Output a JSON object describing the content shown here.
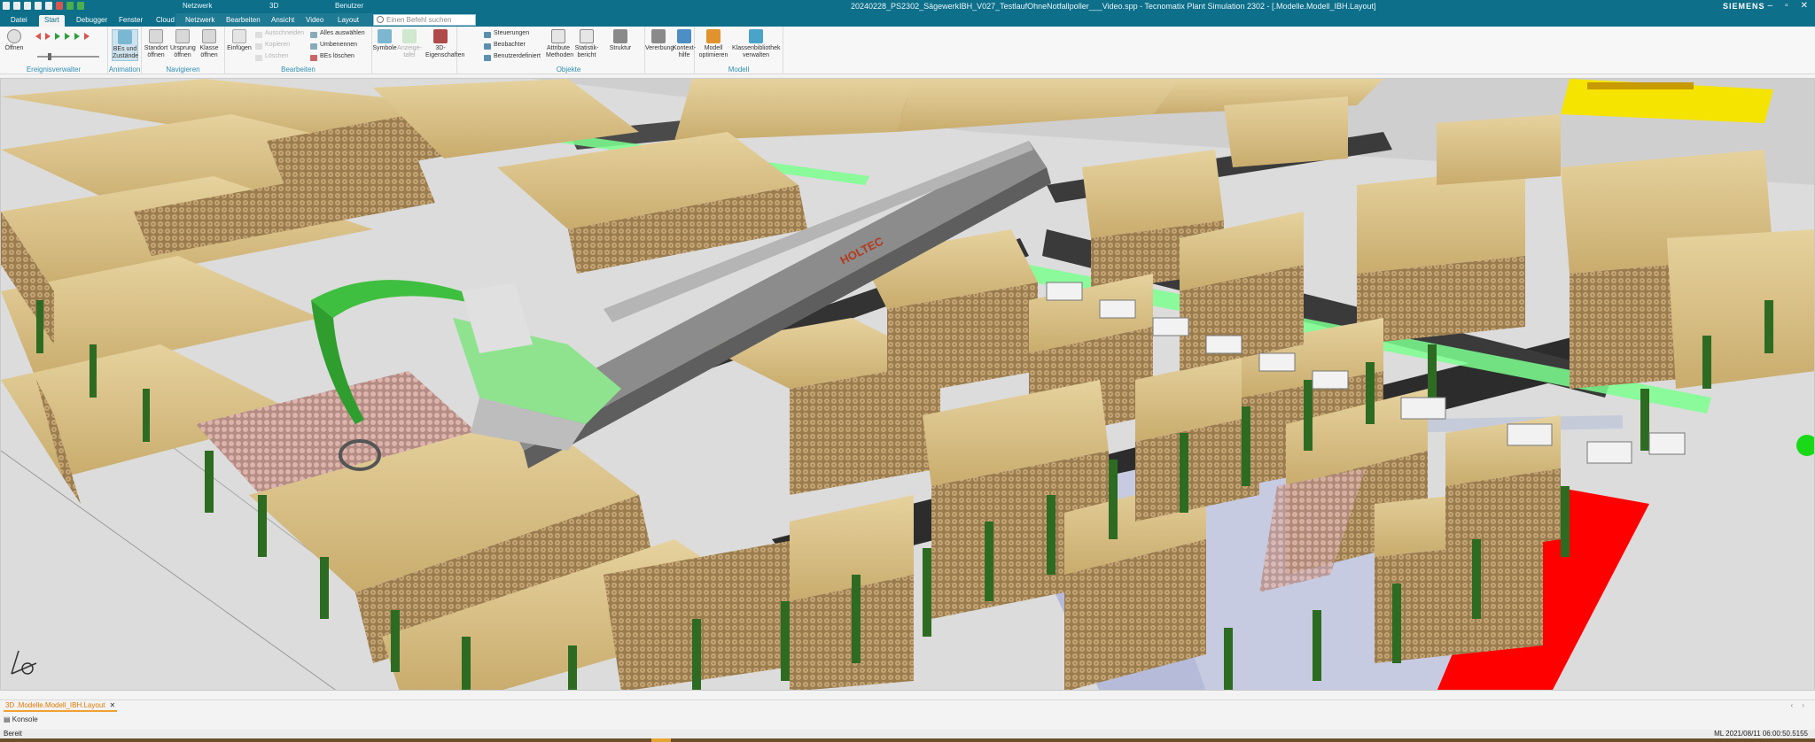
{
  "window": {
    "title": "20240228_PS2302_SägewerkIBH_V027_TestlaufOhneNotfallpoller___Video.spp - Tecnomatix Plant Simulation 2302 - [.Modelle.Modell_IBH.Layout]",
    "brand": "SIEMENS",
    "context_labels": [
      "Netzwerk",
      "3D",
      "Benutzer"
    ]
  },
  "tabs": [
    "Datei",
    "Start",
    "Debugger",
    "Fenster",
    "Cloud",
    "Netzwerk",
    "Bearbeiten",
    "Ansicht",
    "Video",
    "Layout"
  ],
  "active_tab": "Start",
  "search": {
    "placeholder": "Einen Befehl suchen"
  },
  "ribbon": {
    "groups": {
      "ereignisverwalter": "Ereignisverwalter",
      "animation": "Animation",
      "navigieren": "Navigieren",
      "bearbeiten": "Bearbeiten",
      "objekte": "Objekte",
      "modell": "Modell"
    },
    "buttons": {
      "oeffnen": "Öffnen",
      "bes_zustaende": "BEs und Zustände",
      "standort_oeffnen": "Standort öffnen",
      "ursprung_oeffnen": "Ursprung öffnen",
      "klasse_oeffnen": "Klasse öffnen",
      "einfuegen": "Einfügen",
      "ausschneiden": "Ausschneiden",
      "kopieren": "Kopieren",
      "loeschen": "Löschen",
      "alles_auswaehlen": "Alles auswählen",
      "umbenennen": "Umbenennen",
      "bes_loeschen": "BEs löschen",
      "symbole": "Symbole",
      "anzeigetafel": "Anzeige-tafel",
      "eigenschaften_3d": "3D-Eigenschaften",
      "steuerungen": "Steuerungen",
      "beobachter": "Beobachter",
      "benutzerdefiniert": "Benutzerdefiniert",
      "attribute_methoden": "Attribute Methoden",
      "statistikbericht": "Statistik-bericht",
      "struktur": "Struktur",
      "vererbung": "Vererbung",
      "kontexthilfe": "Kontext-hilfe",
      "modell_optimieren": "Modell optimieren",
      "klassenbibliothek": "Klassenbibliothek verwalten"
    }
  },
  "scene": {
    "crane_brand": "HOLTEC",
    "colors": {
      "wood": "#d8c08a",
      "post": "#2e6b22",
      "floor": "#d9d9d9",
      "red_zone": "#ff0000",
      "yellow_machine": "#f5e400",
      "conveyor": "#7dff8f"
    }
  },
  "document_tab": {
    "label": "3D .Modelle.Modell_IBH.Layout",
    "close": "✕"
  },
  "console_label": "Konsole",
  "status": {
    "left": "Bereit",
    "right": "ML 2021/08/11 06:00:50.5155"
  }
}
